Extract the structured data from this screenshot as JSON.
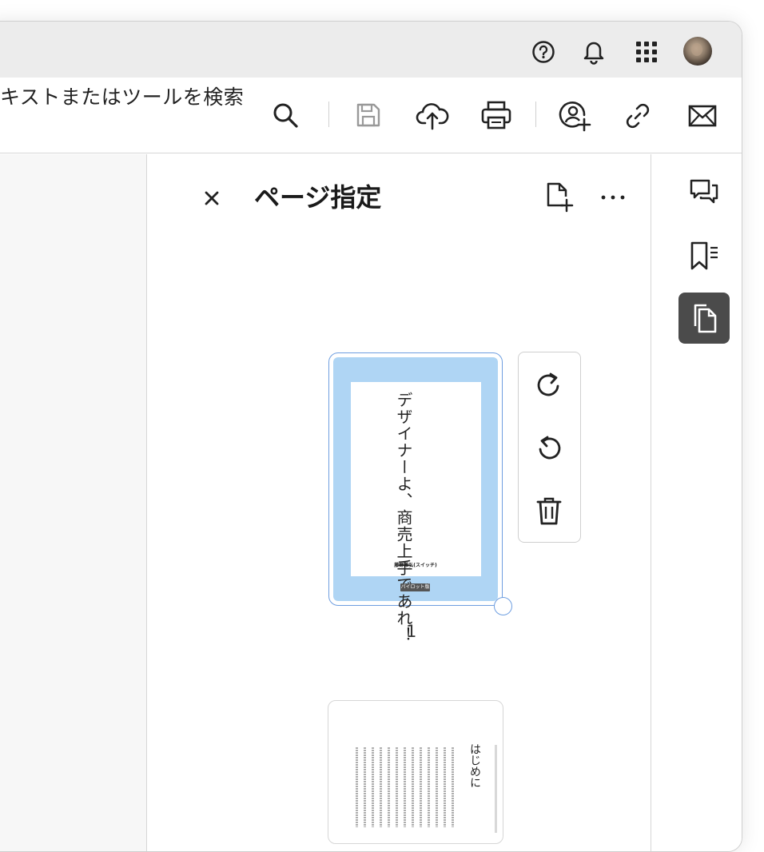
{
  "header": {
    "icons": [
      "help-icon",
      "bell-icon",
      "apps-grid-icon",
      "avatar"
    ]
  },
  "toolbar": {
    "search_placeholder": "キストまたはツールを検索",
    "icons": [
      "search-icon",
      "save-icon",
      "cloud-upload-icon",
      "print-icon",
      "add-user-icon",
      "link-icon",
      "mail-icon"
    ]
  },
  "panel": {
    "title": "ページ指定",
    "close_icon": "close-icon",
    "insert_page_icon": "insert-page-icon",
    "more_icon": "more-icon"
  },
  "pages": [
    {
      "label": "1",
      "title_text": "デザイナーよ、商売上手であれ！",
      "author_text": "藤野雅弘(スイッチ)",
      "badge_text": "パイロット版"
    },
    {
      "heading_text": "はじめに"
    }
  ],
  "page_actions": {
    "icons": [
      "rotate-clockwise-icon",
      "rotate-counterclockwise-icon",
      "delete-icon"
    ]
  },
  "right_rail": {
    "icons": [
      "comments-icon",
      "bookmarks-icon",
      "pages-icon"
    ],
    "active": "pages-icon"
  },
  "colors": {
    "selection_border": "#6e9ee0",
    "thumb_highlight": "#afd5f4",
    "active_rail_bg": "#4b4b4b"
  }
}
